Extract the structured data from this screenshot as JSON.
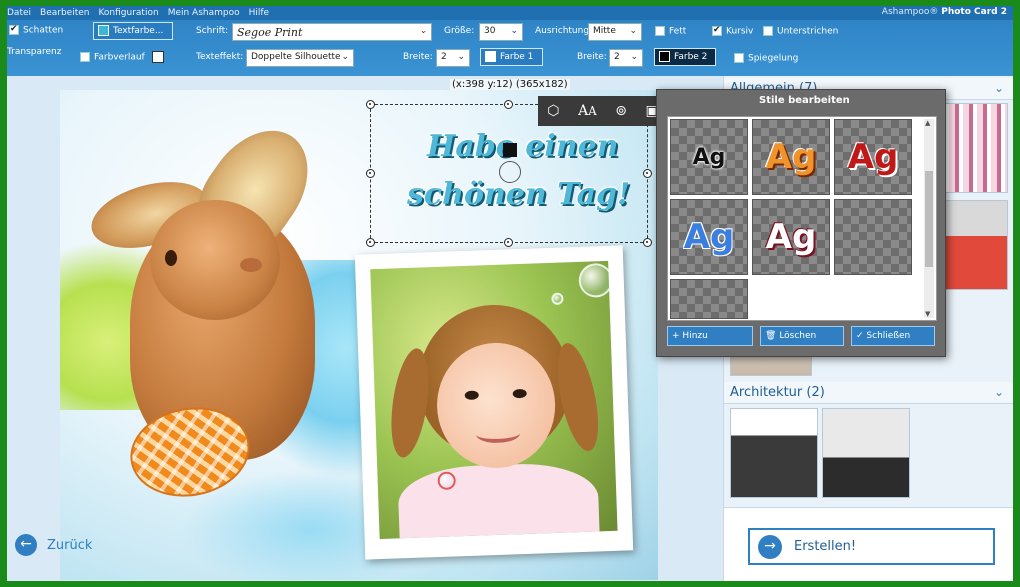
{
  "menu": {
    "items": [
      "Datei",
      "Bearbeiten",
      "Konfiguration",
      "Mein Ashampoo",
      "Hilfe"
    ],
    "app_brand": "Ashampoo®",
    "app_name": "Photo Card 2"
  },
  "toolbar": {
    "schatten_label": "Schatten",
    "transparenz_label": "Transparenz",
    "textfarbe_label": "Textfarbe...",
    "farbverlauf_label": "Farbverlauf",
    "schrift_label": "Schrift:",
    "schrift_value": "Segoe Print",
    "texteffekt_label": "Texteffekt:",
    "texteffekt_value": "Doppelte Silhouette",
    "groesse_label": "Größe:",
    "groesse_value": "30",
    "breite1_label": "Breite:",
    "breite1_value": "2",
    "farbe1_label": "Farbe 1",
    "ausrichtung_label": "Ausrichtung:",
    "ausrichtung_value": "Mitte",
    "breite2_label": "Breite:",
    "breite2_value": "2",
    "farbe2_label": "Farbe 2",
    "fett_label": "Fett",
    "kursiv_label": "Kursiv",
    "unterstrichen_label": "Unterstrichen",
    "spiegelung_label": "Spiegelung",
    "schatten_checked": true,
    "kursiv_checked": true
  },
  "canvas": {
    "coords": "(x:398 y:12) (365x182)",
    "text_line1": "Habe einen",
    "text_line2": "schönen Tag!"
  },
  "back_label": "Zurück",
  "dialog": {
    "title": "Stile bearbeiten",
    "sample_text": "Ag",
    "hinzu_label": "Hinzu",
    "loeschen_label": "Löschen",
    "schliessen_label": "Schließen"
  },
  "right_panel": {
    "sections": [
      {
        "title": "Allgemein (7)"
      },
      {
        "title": "Architektur (2)"
      }
    ],
    "create_label": "Erstellen!"
  },
  "colors": {
    "toolbar_blue": "#2f84c6",
    "accent": "#2f7fc2",
    "text_effect": "#4fb7d8",
    "frame_green": "#1a8a1a"
  }
}
